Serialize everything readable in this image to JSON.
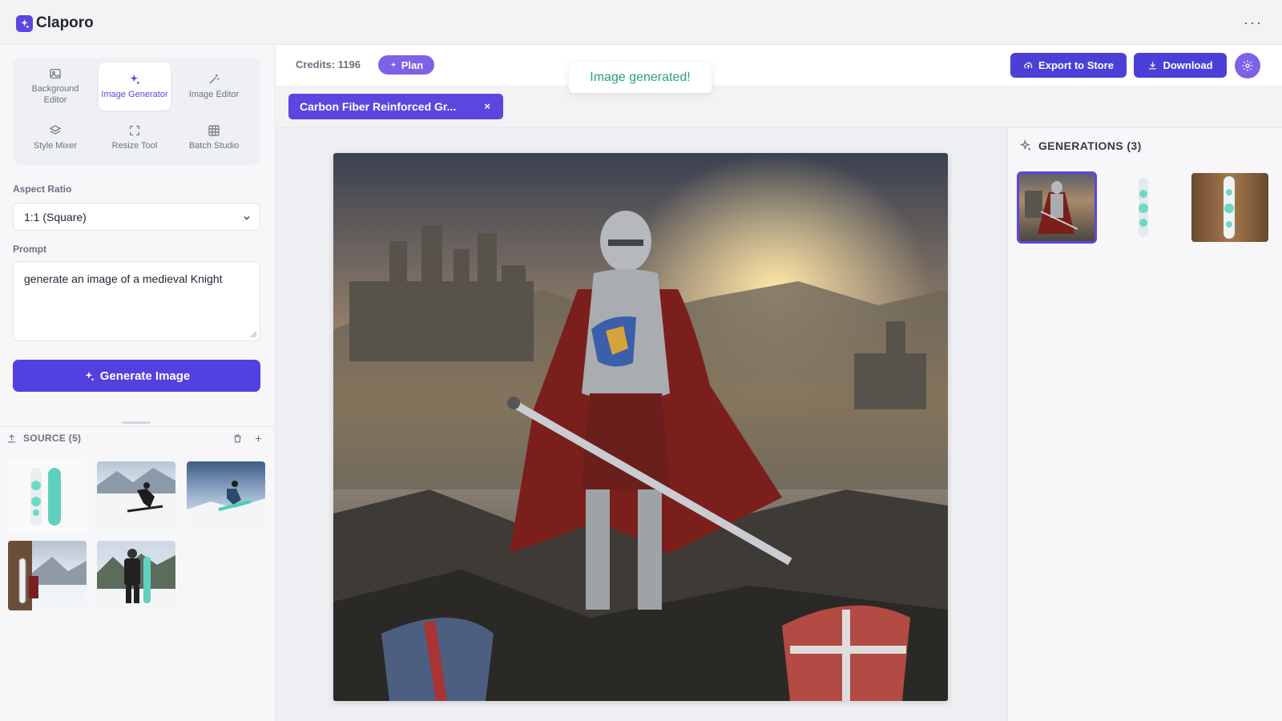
{
  "app": {
    "name": "Claporo",
    "more_label": "···"
  },
  "tools": [
    {
      "label": "Background Editor",
      "icon": "image-icon",
      "active": false
    },
    {
      "label": "Image Generator",
      "icon": "sparkle-icon",
      "active": true
    },
    {
      "label": "Image Editor",
      "icon": "magic-wand-icon",
      "active": false
    },
    {
      "label": "Style Mixer",
      "icon": "layers-icon",
      "active": false
    },
    {
      "label": "Resize Tool",
      "icon": "crop-corners-icon",
      "active": false
    },
    {
      "label": "Batch Studio",
      "icon": "grid-icon",
      "active": false
    }
  ],
  "aspect_ratio": {
    "label": "Aspect Ratio",
    "value": "1:1 (Square)"
  },
  "prompt": {
    "label": "Prompt",
    "value": "generate an image of a medieval Knight"
  },
  "generate_button": "Generate Image",
  "source": {
    "title": "SOURCE (5)",
    "count": 5
  },
  "header": {
    "credits": "Credits: 1196",
    "plan": "Plan",
    "toast": "Image generated!",
    "export": "Export to Store",
    "download": "Download"
  },
  "tab": {
    "label": "Carbon Fiber Reinforced Gr...",
    "close": "×"
  },
  "generations": {
    "title": "GENERATIONS (3)",
    "count": 3,
    "selected_index": 0
  },
  "colors": {
    "accent": "#5b47e0",
    "success": "#2aa36b",
    "plan": "#7d61e6"
  }
}
